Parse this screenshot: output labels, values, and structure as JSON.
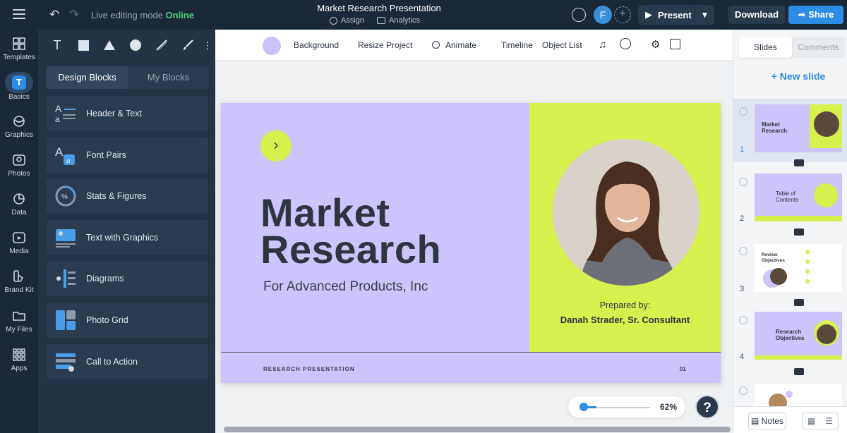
{
  "header": {
    "live_label": "Live editing mode",
    "live_status": "Online",
    "doc_title": "Market Research Presentation",
    "assign": "Assign",
    "analytics": "Analytics",
    "avatar_initial": "F",
    "present": "Present",
    "download": "Download",
    "share": "Share"
  },
  "leftnav": {
    "items": [
      {
        "label": "Templates",
        "icon": "templates-icon"
      },
      {
        "label": "Basics",
        "icon": "basics-icon"
      },
      {
        "label": "Graphics",
        "icon": "graphics-icon"
      },
      {
        "label": "Photos",
        "icon": "photos-icon"
      },
      {
        "label": "Data",
        "icon": "data-icon"
      },
      {
        "label": "Media",
        "icon": "media-icon"
      },
      {
        "label": "Brand Kit",
        "icon": "brand-kit-icon"
      },
      {
        "label": "My Files",
        "icon": "folder-icon"
      },
      {
        "label": "Apps",
        "icon": "apps-icon"
      }
    ],
    "active_glyph": "T"
  },
  "panel": {
    "tabs": [
      "Design Blocks",
      "My Blocks"
    ],
    "blocks": [
      "Header & Text",
      "Font Pairs",
      "Stats & Figures",
      "Text with Graphics",
      "Diagrams",
      "Photo Grid",
      "Call to Action"
    ],
    "tool_text": "T"
  },
  "canvas_toolbar": {
    "background": "Background",
    "resize": "Resize Project",
    "animate": "Animate",
    "timeline": "Timeline",
    "object_list": "Object List"
  },
  "slide": {
    "title_line1": "Market",
    "title_line2": "Research",
    "subtitle": "For Advanced Products, Inc",
    "prepared_label": "Prepared by:",
    "prepared_name": "Danah Strader, Sr. Consultant",
    "footer": "RESEARCH PRESENTATION",
    "page_number": "01"
  },
  "zoom": {
    "level": 62,
    "label": "62%"
  },
  "help": "?",
  "rightpanel": {
    "tabs": [
      "Slides",
      "Comments"
    ],
    "new_slide": "+ New slide",
    "slides": [
      {
        "number": "1",
        "title": "Market Research"
      },
      {
        "number": "2",
        "title": "Table of Contents"
      },
      {
        "number": "3",
        "title": "Review Objectives"
      },
      {
        "number": "4",
        "title": "Research Objectives"
      }
    ],
    "notes": "Notes"
  },
  "colors": {
    "accent": "#2c8ce6",
    "lilac": "#ccc4fb",
    "lime": "#d6f04e",
    "online": "#4cd17a"
  }
}
